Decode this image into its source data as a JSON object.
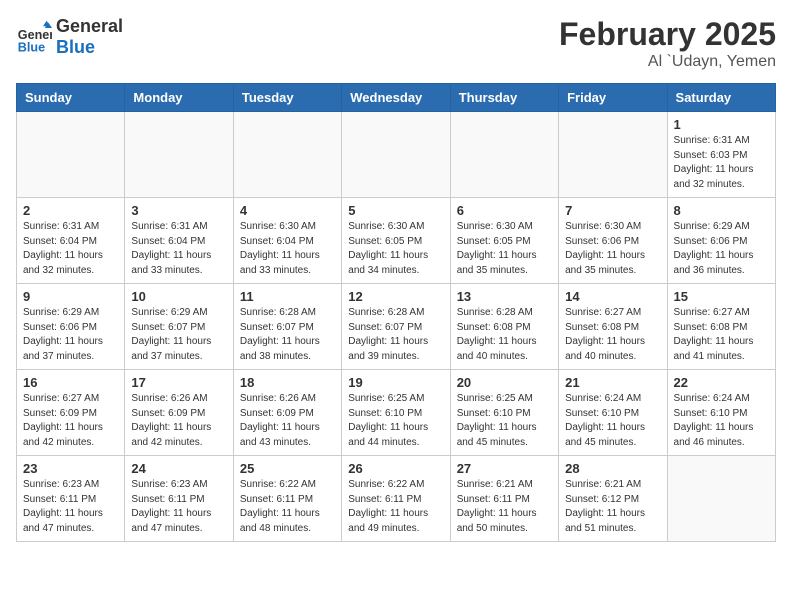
{
  "header": {
    "logo_line1": "General",
    "logo_line2": "Blue",
    "month": "February 2025",
    "location": "Al `Udayn, Yemen"
  },
  "days_of_week": [
    "Sunday",
    "Monday",
    "Tuesday",
    "Wednesday",
    "Thursday",
    "Friday",
    "Saturday"
  ],
  "weeks": [
    [
      {
        "day": "",
        "info": ""
      },
      {
        "day": "",
        "info": ""
      },
      {
        "day": "",
        "info": ""
      },
      {
        "day": "",
        "info": ""
      },
      {
        "day": "",
        "info": ""
      },
      {
        "day": "",
        "info": ""
      },
      {
        "day": "1",
        "info": "Sunrise: 6:31 AM\nSunset: 6:03 PM\nDaylight: 11 hours\nand 32 minutes."
      }
    ],
    [
      {
        "day": "2",
        "info": "Sunrise: 6:31 AM\nSunset: 6:04 PM\nDaylight: 11 hours\nand 32 minutes."
      },
      {
        "day": "3",
        "info": "Sunrise: 6:31 AM\nSunset: 6:04 PM\nDaylight: 11 hours\nand 33 minutes."
      },
      {
        "day": "4",
        "info": "Sunrise: 6:30 AM\nSunset: 6:04 PM\nDaylight: 11 hours\nand 33 minutes."
      },
      {
        "day": "5",
        "info": "Sunrise: 6:30 AM\nSunset: 6:05 PM\nDaylight: 11 hours\nand 34 minutes."
      },
      {
        "day": "6",
        "info": "Sunrise: 6:30 AM\nSunset: 6:05 PM\nDaylight: 11 hours\nand 35 minutes."
      },
      {
        "day": "7",
        "info": "Sunrise: 6:30 AM\nSunset: 6:06 PM\nDaylight: 11 hours\nand 35 minutes."
      },
      {
        "day": "8",
        "info": "Sunrise: 6:29 AM\nSunset: 6:06 PM\nDaylight: 11 hours\nand 36 minutes."
      }
    ],
    [
      {
        "day": "9",
        "info": "Sunrise: 6:29 AM\nSunset: 6:06 PM\nDaylight: 11 hours\nand 37 minutes."
      },
      {
        "day": "10",
        "info": "Sunrise: 6:29 AM\nSunset: 6:07 PM\nDaylight: 11 hours\nand 37 minutes."
      },
      {
        "day": "11",
        "info": "Sunrise: 6:28 AM\nSunset: 6:07 PM\nDaylight: 11 hours\nand 38 minutes."
      },
      {
        "day": "12",
        "info": "Sunrise: 6:28 AM\nSunset: 6:07 PM\nDaylight: 11 hours\nand 39 minutes."
      },
      {
        "day": "13",
        "info": "Sunrise: 6:28 AM\nSunset: 6:08 PM\nDaylight: 11 hours\nand 40 minutes."
      },
      {
        "day": "14",
        "info": "Sunrise: 6:27 AM\nSunset: 6:08 PM\nDaylight: 11 hours\nand 40 minutes."
      },
      {
        "day": "15",
        "info": "Sunrise: 6:27 AM\nSunset: 6:08 PM\nDaylight: 11 hours\nand 41 minutes."
      }
    ],
    [
      {
        "day": "16",
        "info": "Sunrise: 6:27 AM\nSunset: 6:09 PM\nDaylight: 11 hours\nand 42 minutes."
      },
      {
        "day": "17",
        "info": "Sunrise: 6:26 AM\nSunset: 6:09 PM\nDaylight: 11 hours\nand 42 minutes."
      },
      {
        "day": "18",
        "info": "Sunrise: 6:26 AM\nSunset: 6:09 PM\nDaylight: 11 hours\nand 43 minutes."
      },
      {
        "day": "19",
        "info": "Sunrise: 6:25 AM\nSunset: 6:10 PM\nDaylight: 11 hours\nand 44 minutes."
      },
      {
        "day": "20",
        "info": "Sunrise: 6:25 AM\nSunset: 6:10 PM\nDaylight: 11 hours\nand 45 minutes."
      },
      {
        "day": "21",
        "info": "Sunrise: 6:24 AM\nSunset: 6:10 PM\nDaylight: 11 hours\nand 45 minutes."
      },
      {
        "day": "22",
        "info": "Sunrise: 6:24 AM\nSunset: 6:10 PM\nDaylight: 11 hours\nand 46 minutes."
      }
    ],
    [
      {
        "day": "23",
        "info": "Sunrise: 6:23 AM\nSunset: 6:11 PM\nDaylight: 11 hours\nand 47 minutes."
      },
      {
        "day": "24",
        "info": "Sunrise: 6:23 AM\nSunset: 6:11 PM\nDaylight: 11 hours\nand 47 minutes."
      },
      {
        "day": "25",
        "info": "Sunrise: 6:22 AM\nSunset: 6:11 PM\nDaylight: 11 hours\nand 48 minutes."
      },
      {
        "day": "26",
        "info": "Sunrise: 6:22 AM\nSunset: 6:11 PM\nDaylight: 11 hours\nand 49 minutes."
      },
      {
        "day": "27",
        "info": "Sunrise: 6:21 AM\nSunset: 6:11 PM\nDaylight: 11 hours\nand 50 minutes."
      },
      {
        "day": "28",
        "info": "Sunrise: 6:21 AM\nSunset: 6:12 PM\nDaylight: 11 hours\nand 51 minutes."
      },
      {
        "day": "",
        "info": ""
      }
    ]
  ]
}
